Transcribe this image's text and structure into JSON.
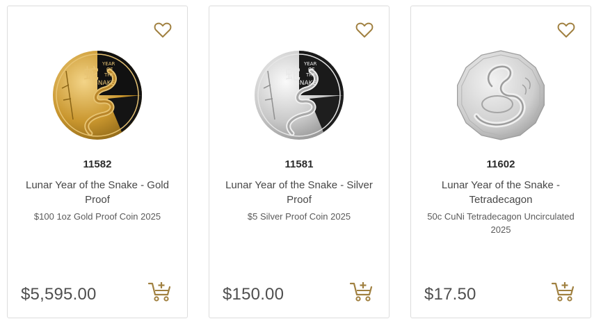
{
  "colors": {
    "accent": "#a08040",
    "border": "#dcdcdc"
  },
  "products": [
    {
      "sku": "11582",
      "title": "Lunar Year of the Snake - Gold Proof",
      "subtitle": "$100 1oz Gold Proof Coin 2025",
      "price": "$5,595.00",
      "coin_icon": "gold-coin-image",
      "coin_text": [
        "YEAR",
        "OF",
        "THE",
        "SNAKE"
      ]
    },
    {
      "sku": "11581",
      "title": "Lunar Year of the Snake - Silver Proof",
      "subtitle": "$5 Silver Proof Coin 2025",
      "price": "$150.00",
      "coin_icon": "silver-coin-image",
      "coin_text": [
        "YEAR",
        "OF",
        "THE",
        "SNAKE"
      ]
    },
    {
      "sku": "11602",
      "title": "Lunar Year of the Snake - Tetradecagon",
      "subtitle": "50c CuNi Tetradecagon Uncirculated 2025",
      "price": "$17.50",
      "coin_icon": "tetradecagon-coin-image"
    }
  ]
}
